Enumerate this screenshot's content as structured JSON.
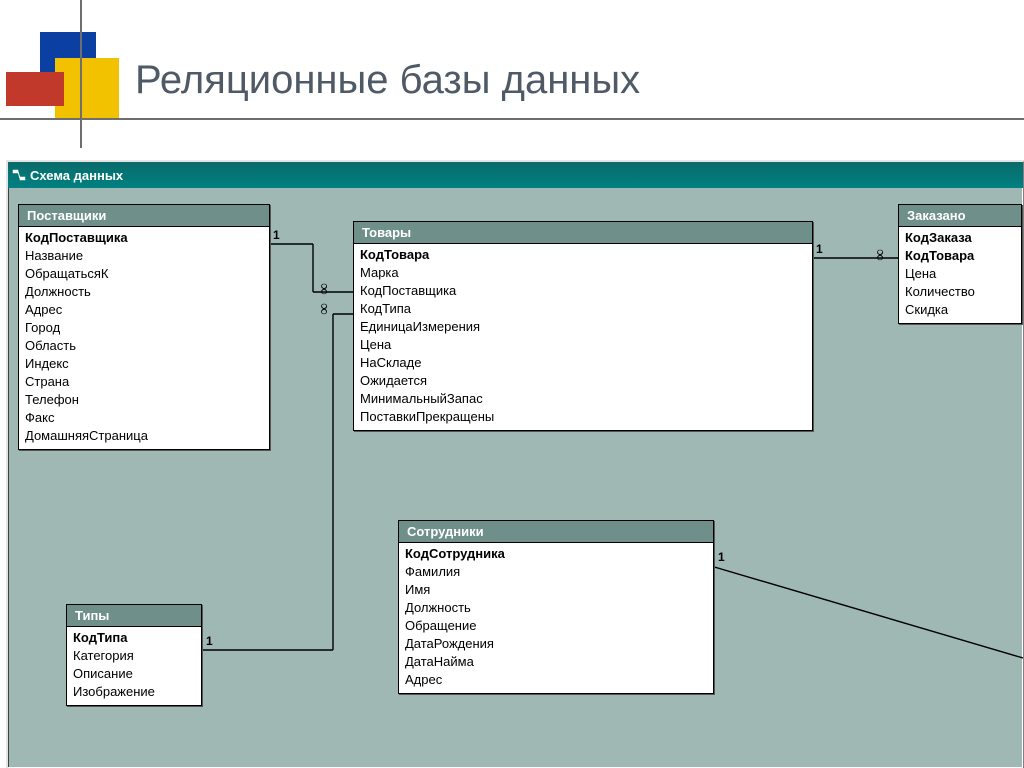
{
  "slide": {
    "title": "Реляционные базы данных"
  },
  "window": {
    "title": "Схема данных"
  },
  "entities": {
    "suppliers": {
      "title": "Поставщики",
      "fields": [
        "КодПоставщика",
        "Название",
        "ОбращатьсяК",
        "Должность",
        "Адрес",
        "Город",
        "Область",
        "Индекс",
        "Страна",
        "Телефон",
        "Факс",
        "ДомашняяСтраница"
      ],
      "primary_keys": [
        "КодПоставщика"
      ]
    },
    "products": {
      "title": "Товары",
      "fields": [
        "КодТовара",
        "Марка",
        "КодПоставщика",
        "КодТипа",
        "ЕдиницаИзмерения",
        "Цена",
        "НаСкладе",
        "Ожидается",
        "МинимальныйЗапас",
        "ПоставкиПрекращены"
      ],
      "primary_keys": [
        "КодТовара"
      ]
    },
    "ordered": {
      "title": "Заказано",
      "fields": [
        "КодЗаказа",
        "КодТовара",
        "Цена",
        "Количество",
        "Скидка"
      ],
      "primary_keys": [
        "КодЗаказа",
        "КодТовара"
      ]
    },
    "types": {
      "title": "Типы",
      "fields": [
        "КодТипа",
        "Категория",
        "Описание",
        "Изображение"
      ],
      "primary_keys": [
        "КодТипа"
      ]
    },
    "employees": {
      "title": "Сотрудники",
      "fields": [
        "КодСотрудника",
        "Фамилия",
        "Имя",
        "Должность",
        "Обращение",
        "ДатаРождения",
        "ДатаНайма",
        "Адрес"
      ],
      "primary_keys": [
        "КодСотрудника"
      ]
    }
  },
  "relationships": [
    {
      "from": "suppliers",
      "to": "products",
      "card_from": "1",
      "card_to": "∞"
    },
    {
      "from": "products",
      "to": "ordered",
      "card_from": "1",
      "card_to": "∞"
    },
    {
      "from": "types",
      "to": "products",
      "card_from": "1",
      "card_to": "∞"
    },
    {
      "from": "employees",
      "to": "(off-canvas)",
      "card_from": "1",
      "card_to": ""
    }
  ],
  "labels": {
    "rel_sp_1": "1",
    "rel_sp_inf": "∞",
    "rel_po_1": "1",
    "rel_po_inf": "∞",
    "rel_tp_1": "1",
    "rel_tp_inf": "∞",
    "rel_emp_1": "1"
  }
}
